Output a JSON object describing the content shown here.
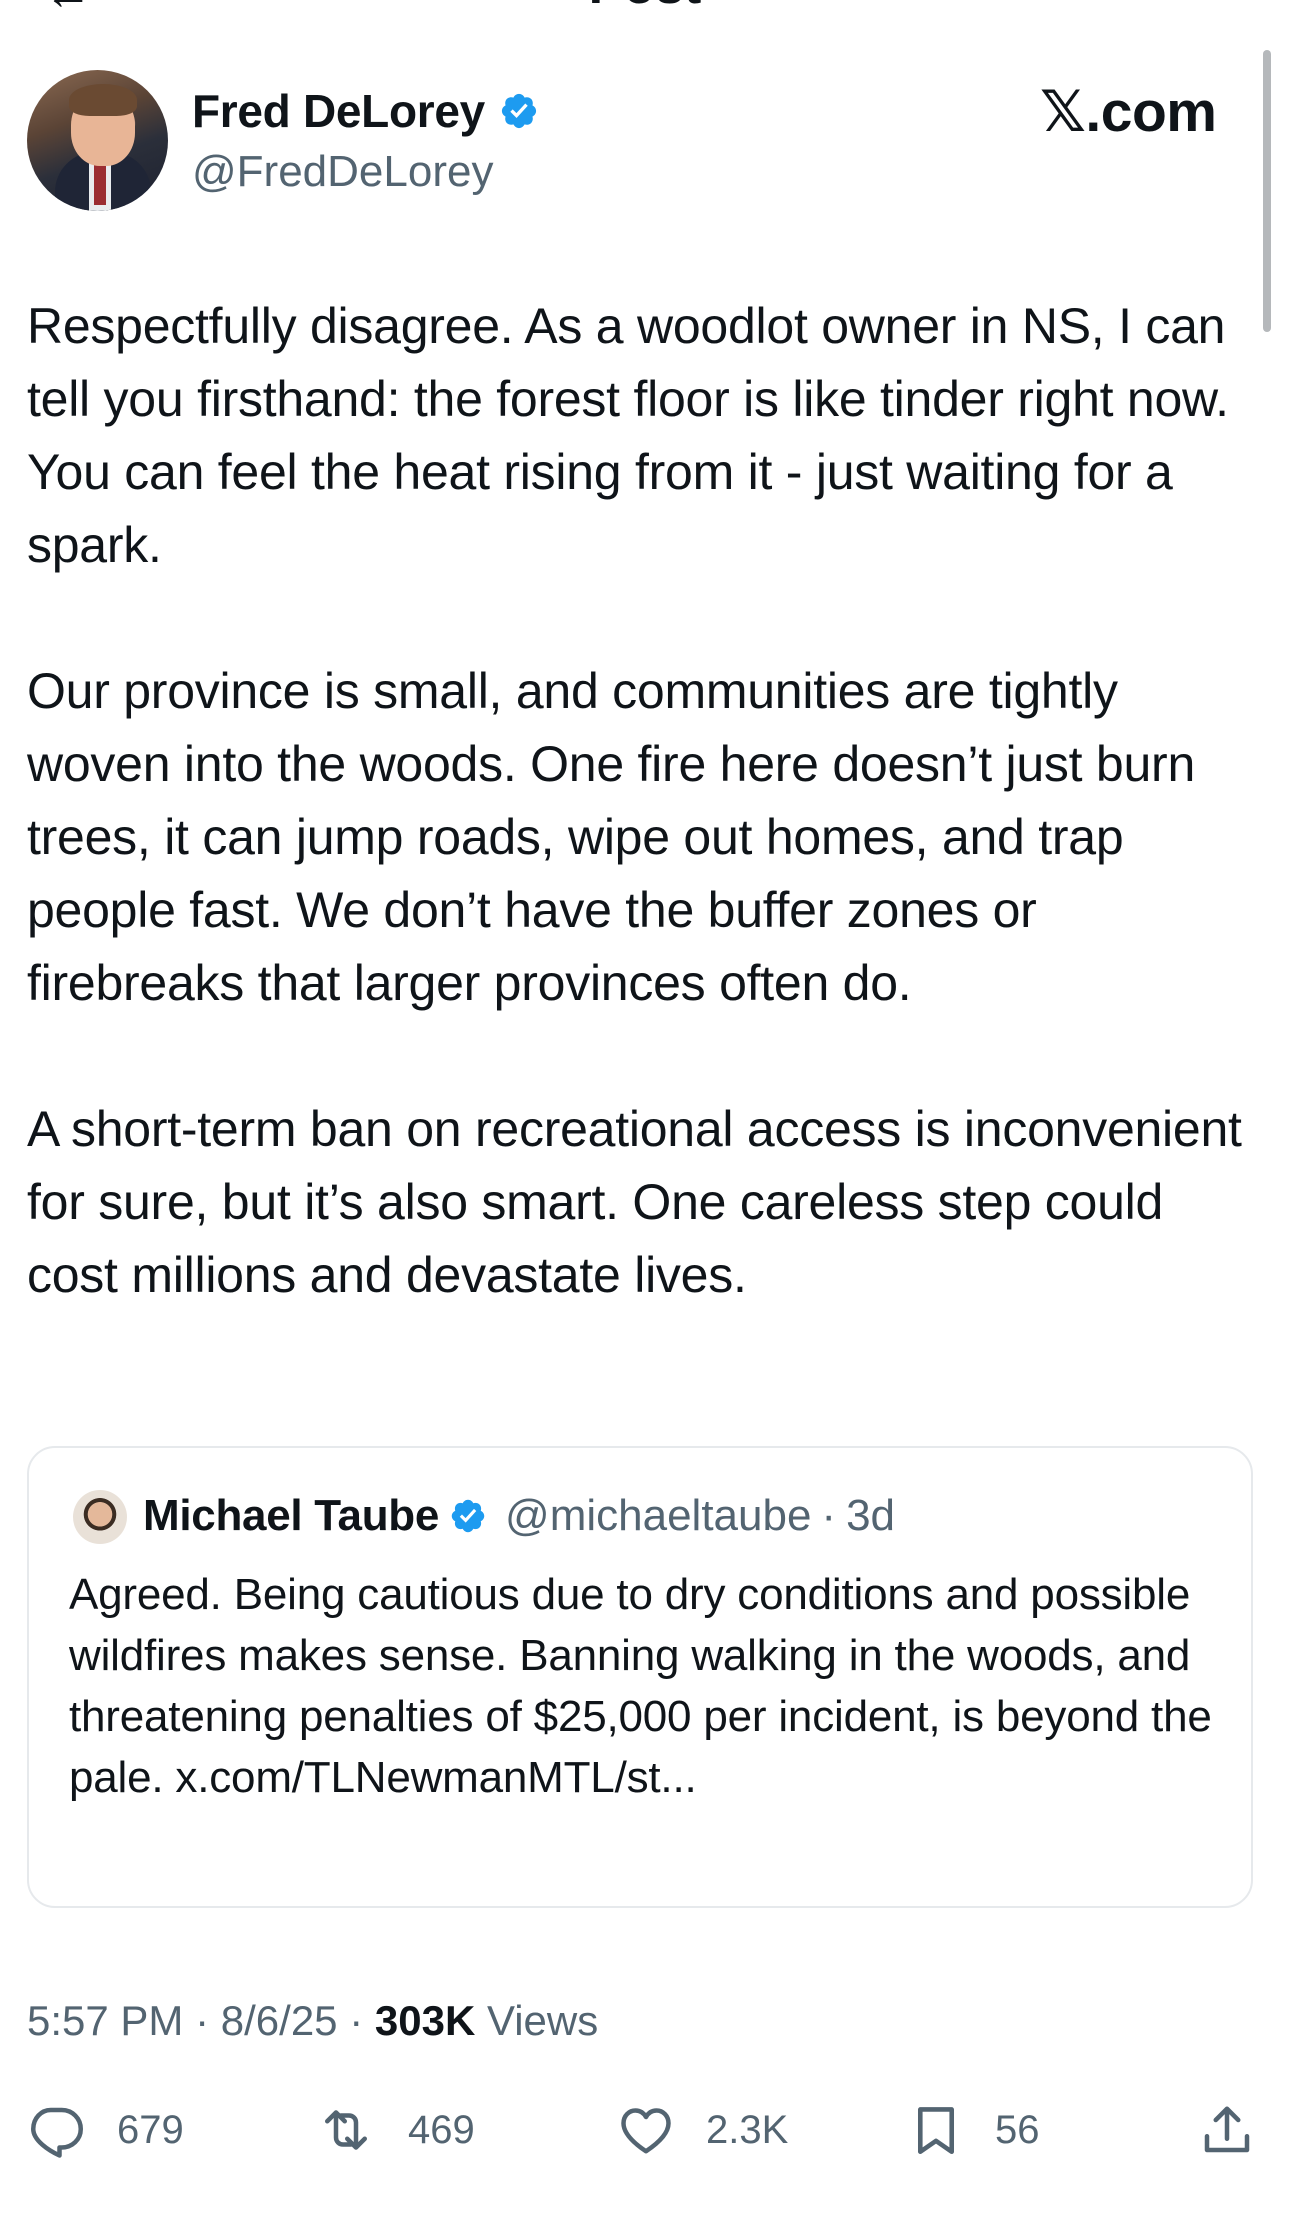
{
  "header": {
    "title": "Post"
  },
  "author": {
    "name": "Fred DeLorey",
    "handle": "@FredDeLorey",
    "verified": true
  },
  "source_watermark": "𝕏.com",
  "post": {
    "text": "Respectfully disagree. As a woodlot owner in NS, I can tell you firsthand: the forest floor is like tinder right now. You can feel the heat rising from it - just waiting for a spark.\n\nOur province is small, and communities are tightly woven into the woods. One fire here doesn’t just burn trees, it can jump roads, wipe out homes, and trap people fast. We don’t have the buffer zones or firebreaks that larger provinces often do.\n\nA short-term ban on recreational access is inconvenient for sure, but it’s also smart. One careless step could cost millions and devastate lives."
  },
  "quoted_post": {
    "name": "Michael Taube",
    "handle": "@michaeltaube",
    "separator": "·",
    "age": "3d",
    "verified": true,
    "text": "Agreed. Being cautious due to dry conditions and possible wildfires makes sense. Banning walking in the woods, and threatening penalties of $25,000 per incident, is beyond the pale. x.com/TLNewmanMTL/st..."
  },
  "meta": {
    "time": "5:57 PM",
    "date": "8/6/25",
    "separator": "·",
    "views_count": "303K",
    "views_label": "Views"
  },
  "actions": {
    "replies": "679",
    "reposts": "469",
    "likes": "2.3K",
    "bookmarks": "56"
  },
  "colors": {
    "text": "#0f1419",
    "secondary": "#536471",
    "verified": "#1d9bf0",
    "border": "#e6e9ec"
  },
  "icons": {
    "verified": "verified-badge-icon",
    "reply": "reply-icon",
    "repost": "repost-icon",
    "like": "heart-icon",
    "bookmark": "bookmark-icon",
    "share": "share-icon"
  }
}
